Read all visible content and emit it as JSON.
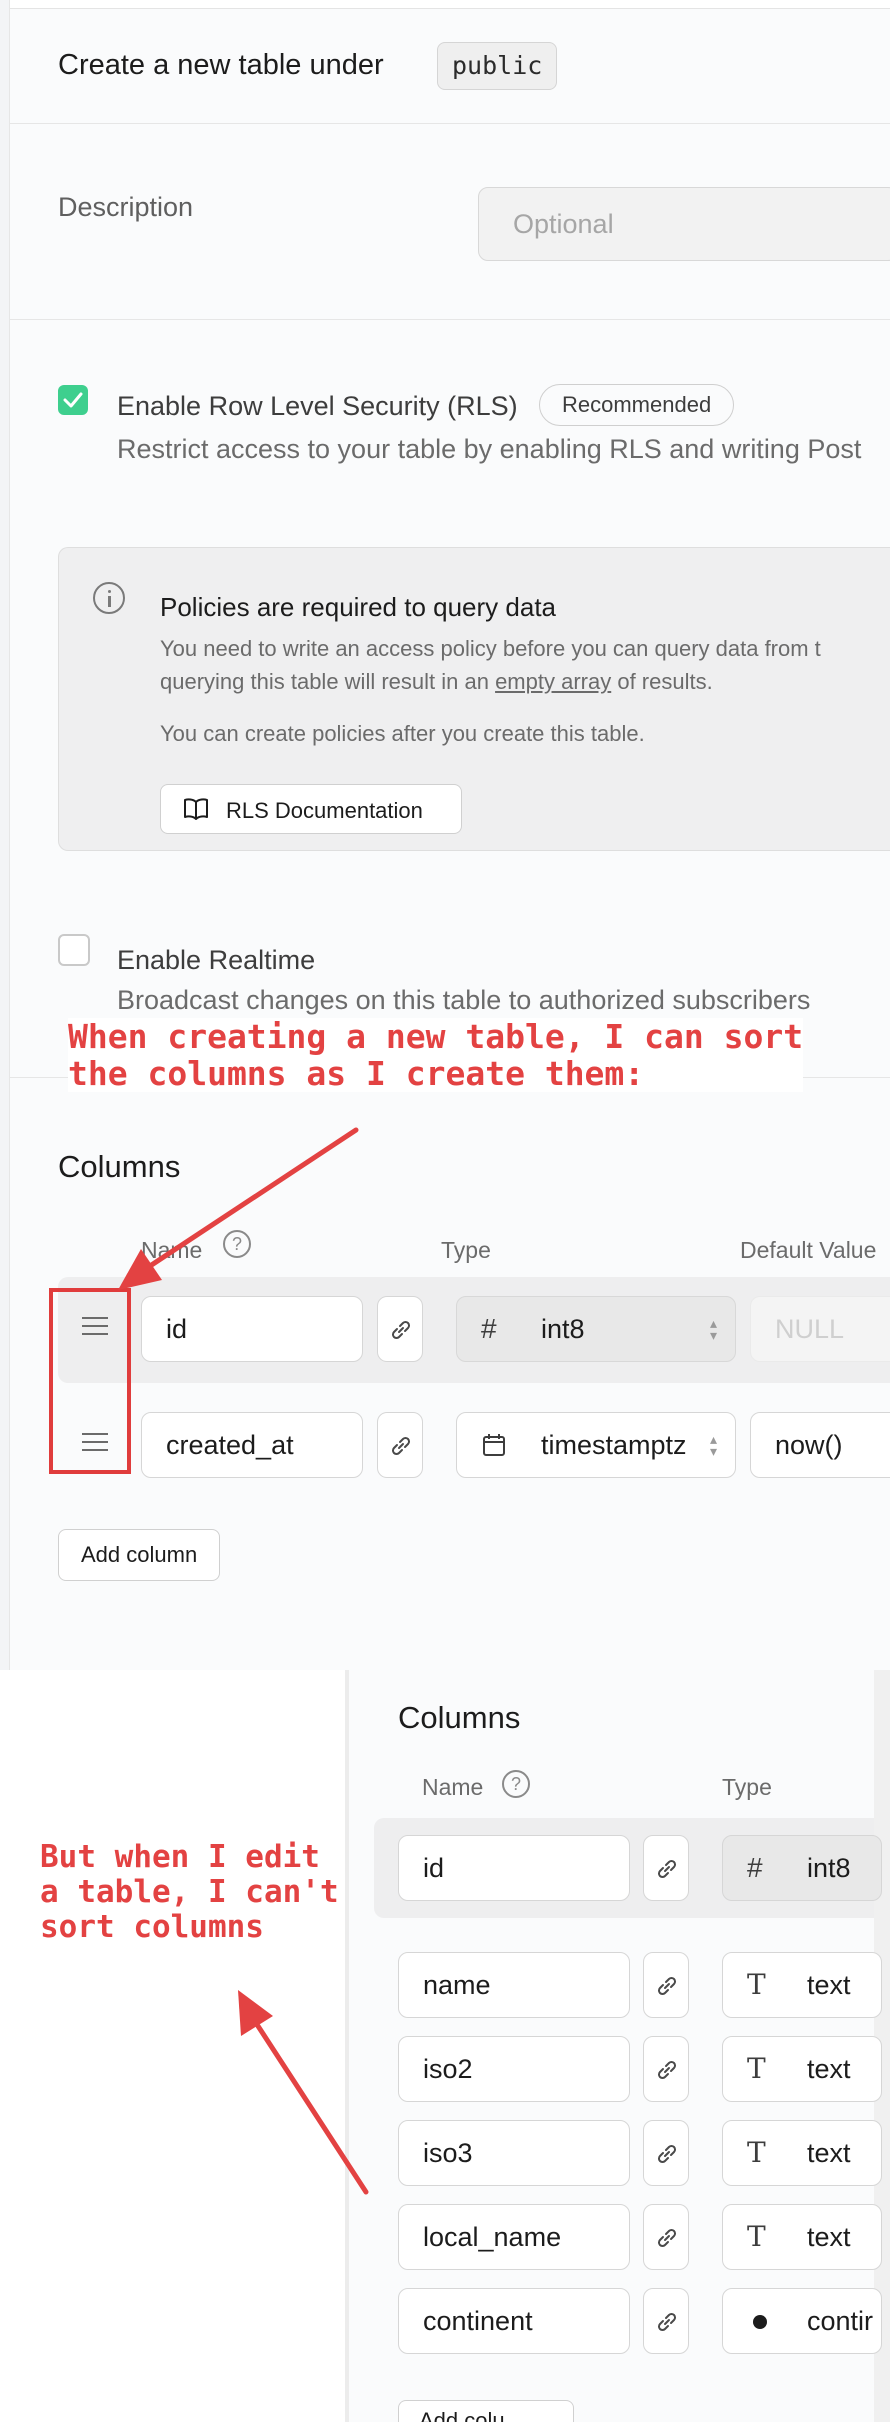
{
  "create_form": {
    "title": "Create a new table under",
    "schema": "public",
    "description_label": "Description",
    "description_placeholder": "Optional",
    "rls": {
      "checked": true,
      "label": "Enable Row Level Security (RLS)",
      "badge": "Recommended",
      "description": "Restrict access to your table by enabling RLS and writing Post"
    },
    "policy_notice": {
      "title": "Policies are required to query data",
      "line1": "You need to write an access policy before you can query data from t",
      "line2_before": "querying this table will result in an ",
      "line2_link": "empty array",
      "line2_after": " of results.",
      "line3": "You can create policies after you create this table.",
      "doc_button": "RLS Documentation"
    },
    "realtime": {
      "checked": false,
      "label": "Enable Realtime",
      "description": "Broadcast changes on this table to authorized subscribers"
    },
    "columns": {
      "title": "Columns",
      "headers": {
        "name": "Name",
        "type": "Type",
        "default": "Default Value"
      },
      "rows": [
        {
          "name": "id",
          "type_icon": "#",
          "type": "int8",
          "default": "NULL"
        },
        {
          "name": "created_at",
          "type_icon": "calendar-icon",
          "type": "timestamptz",
          "default": "now()"
        }
      ],
      "add_button": "Add column"
    }
  },
  "edit_form": {
    "columns": {
      "title": "Columns",
      "headers": {
        "name": "Name",
        "type": "Type"
      },
      "rows": [
        {
          "name": "id",
          "type_icon": "#",
          "type": "int8"
        },
        {
          "name": "name",
          "type_icon": "T",
          "type": "text"
        },
        {
          "name": "iso2",
          "type_icon": "T",
          "type": "text"
        },
        {
          "name": "iso3",
          "type_icon": "T",
          "type": "text"
        },
        {
          "name": "local_name",
          "type_icon": "T",
          "type": "text"
        },
        {
          "name": "continent",
          "type_icon": "dot-icon",
          "type": "contir"
        }
      ],
      "add_button": "Add colu"
    }
  },
  "annotations": {
    "callout_top_line1": "When creating a new table, I can sort",
    "callout_top_line2": "the columns as I create them:",
    "callout_bottom_line1": "But when I edit",
    "callout_bottom_line2": "a table, I can't",
    "callout_bottom_line3": "sort columns",
    "color": "#e34242"
  },
  "colors": {
    "accent_green": "#3ecf8e",
    "annotation_red": "#e03c3c"
  }
}
